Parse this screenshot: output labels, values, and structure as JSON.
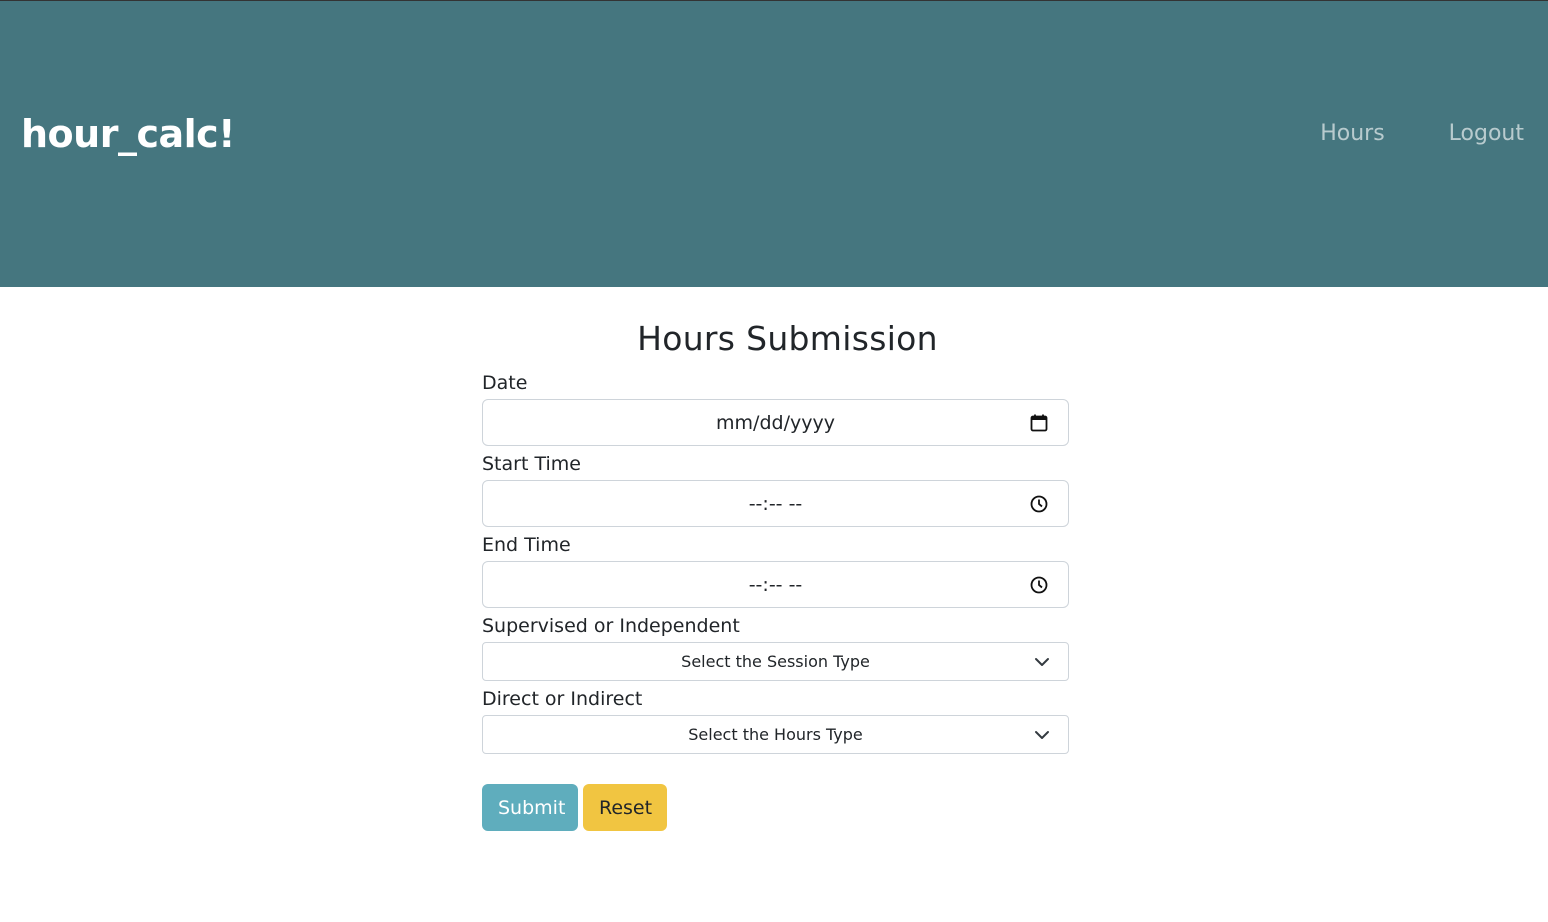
{
  "navbar": {
    "brand": "hour_calc!",
    "links": [
      "Hours",
      "Logout"
    ],
    "bg_color": "#45767f"
  },
  "form": {
    "title": "Hours Submission",
    "date": {
      "label": "Date",
      "placeholder": "mm/dd/yyyy",
      "icon": "calendar-icon"
    },
    "start_time": {
      "label": "Start Time",
      "placeholder": "--:-- --",
      "icon": "clock-icon"
    },
    "end_time": {
      "label": "End Time",
      "placeholder": "--:-- --",
      "icon": "clock-icon"
    },
    "session_type": {
      "label": "Supervised or Independent",
      "selected": "Select the Session Type",
      "icon": "chevron-down-icon"
    },
    "hours_type": {
      "label": "Direct or Indirect",
      "selected": "Select the Hours Type",
      "icon": "chevron-down-icon"
    },
    "submit_label": "Submit",
    "reset_label": "Reset",
    "submit_color": "#5fadbd",
    "reset_color": "#f1c541"
  }
}
